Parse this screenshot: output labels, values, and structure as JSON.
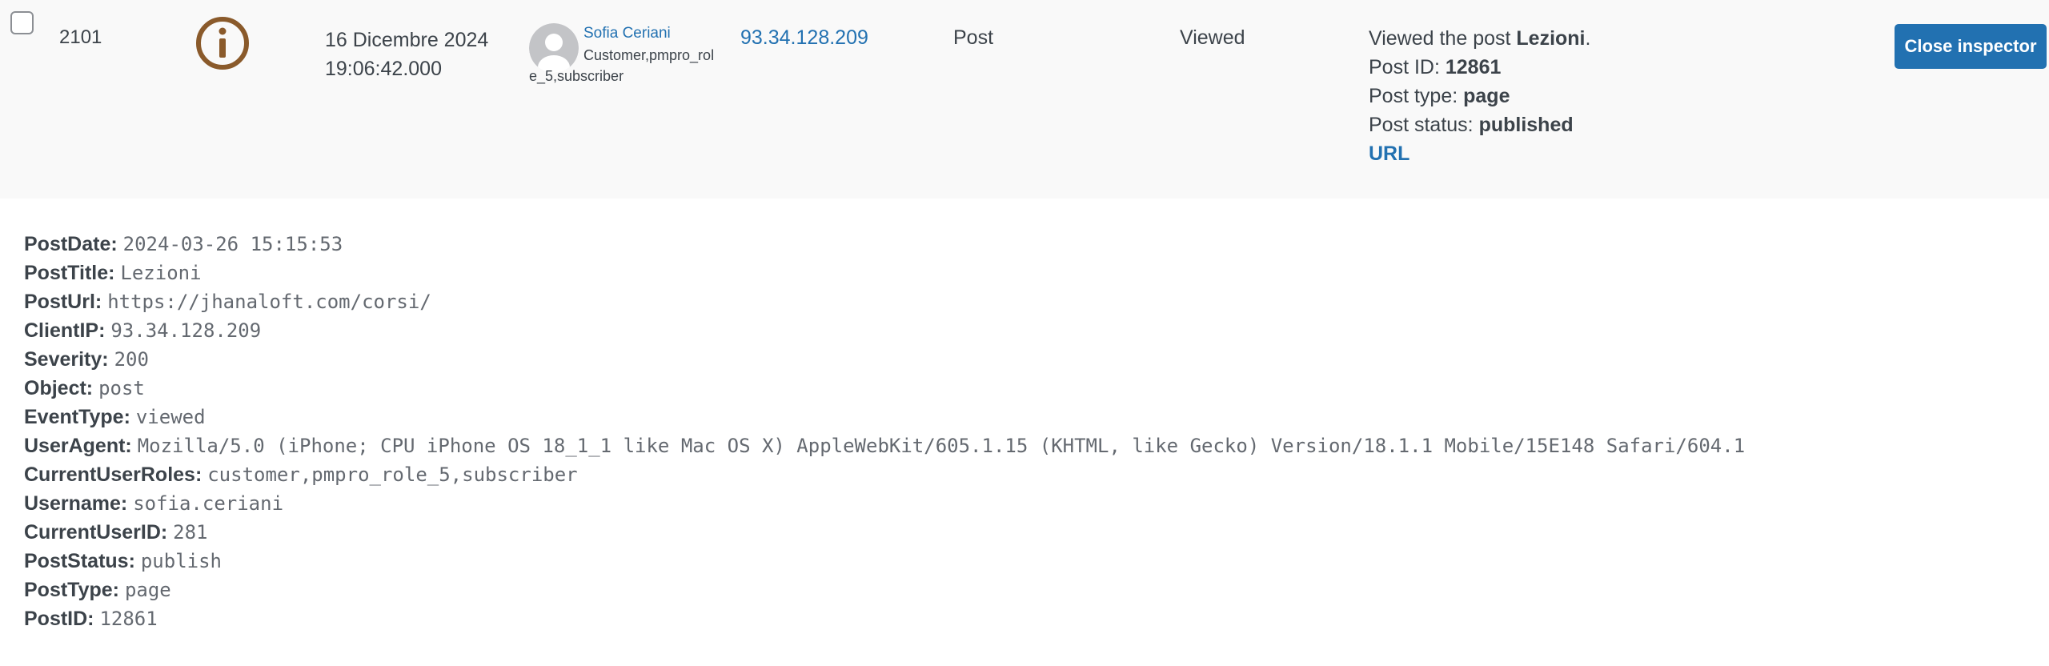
{
  "event": {
    "id": "2101",
    "date_line1": "16 Dicembre 2024",
    "date_line2": "19:06:42.000",
    "user_name": "Sofia Ceriani",
    "user_roles": "Customer,pmpro_role_5,subscriber",
    "client_ip": "93.34.128.209",
    "object": "Post",
    "event_type": "Viewed",
    "severity_icon": "info-icon",
    "message": {
      "prefix": "Viewed the post ",
      "post_title": "Lezioni",
      "suffix": ".",
      "post_id_label": "Post ID: ",
      "post_id": "12861",
      "post_type_label": "Post type: ",
      "post_type": "page",
      "post_status_label": "Post status: ",
      "post_status": "published",
      "url_label": "URL"
    }
  },
  "buttons": {
    "close_inspector": "Close inspector"
  },
  "colors": {
    "accent": "#2271b1",
    "severity_info": "#8a5a2b",
    "row_background": "#f9f9f9"
  },
  "inspector": {
    "fields": [
      {
        "key": "PostDate:",
        "value": "2024-03-26 15:15:53"
      },
      {
        "key": "PostTitle:",
        "value": "Lezioni"
      },
      {
        "key": "PostUrl:",
        "value": "https://jhanaloft.com/corsi/"
      },
      {
        "key": "ClientIP:",
        "value": "93.34.128.209"
      },
      {
        "key": "Severity:",
        "value": "200"
      },
      {
        "key": "Object:",
        "value": "post"
      },
      {
        "key": "EventType:",
        "value": "viewed"
      },
      {
        "key": "UserAgent:",
        "value": "Mozilla/5.0 (iPhone; CPU iPhone OS 18_1_1 like Mac OS X) AppleWebKit/605.1.15 (KHTML, like Gecko) Version/18.1.1 Mobile/15E148 Safari/604.1"
      },
      {
        "key": "CurrentUserRoles:",
        "value": "customer,pmpro_role_5,subscriber"
      },
      {
        "key": "Username:",
        "value": "sofia.ceriani"
      },
      {
        "key": "CurrentUserID:",
        "value": "281"
      },
      {
        "key": "PostStatus:",
        "value": "publish"
      },
      {
        "key": "PostType:",
        "value": "page"
      },
      {
        "key": "PostID:",
        "value": "12861"
      }
    ]
  }
}
